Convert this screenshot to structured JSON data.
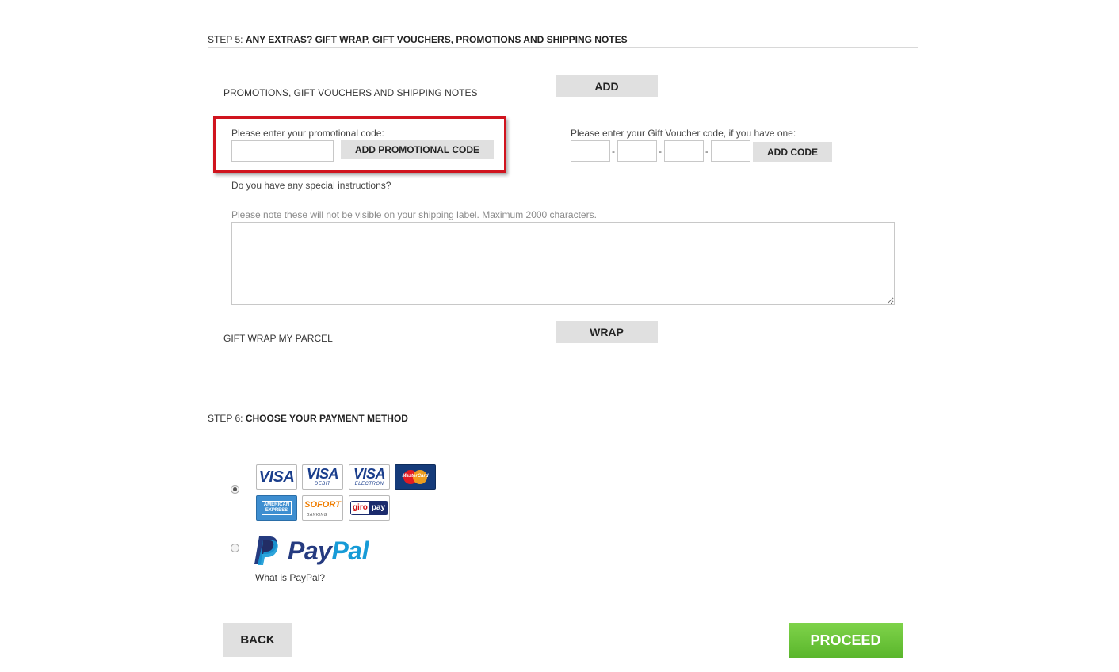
{
  "step5": {
    "prefix": "STEP 5:",
    "title": "ANY EXTRAS? GIFT WRAP, GIFT VOUCHERS, PROMOTIONS AND SHIPPING NOTES"
  },
  "promotions": {
    "row_label": "PROMOTIONS, GIFT VOUCHERS AND SHIPPING NOTES",
    "add_label": "ADD",
    "promo_label": "Please enter your promotional code:",
    "promo_value": "",
    "promo_button": "ADD PROMOTIONAL CODE",
    "voucher_label": "Please enter your Gift Voucher code, if you have one:",
    "voucher_parts": [
      "",
      "",
      "",
      ""
    ],
    "voucher_separator": "-",
    "voucher_button": "ADD CODE",
    "instructions_label": "Do you have any special instructions?",
    "instructions_note": "Please note these will not be visible on your shipping label. Maximum 2000 characters.",
    "instructions_value": ""
  },
  "giftwrap": {
    "row_label": "GIFT WRAP MY PARCEL",
    "button": "WRAP"
  },
  "step6": {
    "prefix": "STEP 6:",
    "title": "CHOOSE YOUR PAYMENT METHOD"
  },
  "payment": {
    "cards": {
      "visa": "VISA",
      "visa_debit": "VISA",
      "visa_debit_sub": "DEBIT",
      "visa_electron": "VISA",
      "visa_electron_sub": "ELECTRON",
      "mastercard": "MasterCard",
      "amex_line1": "AMERICAN",
      "amex_line2": "EXPRESS",
      "sofort": "SOFORT",
      "sofort_sub": "BANKING",
      "giro_1": "giro",
      "giro_2": "pay"
    },
    "card_selected": true,
    "paypal_selected": false,
    "paypal_word_1": "Pay",
    "paypal_word_2": "Pal",
    "paypal_link": "What is PayPal?"
  },
  "nav": {
    "back": "BACK",
    "proceed": "PROCEED"
  },
  "colors": {
    "highlight": "#d0141e",
    "proceed": "#6cc33a",
    "grey_button": "#e0e0e0",
    "paypal_dark": "#253b80",
    "paypal_light": "#179bd7"
  }
}
